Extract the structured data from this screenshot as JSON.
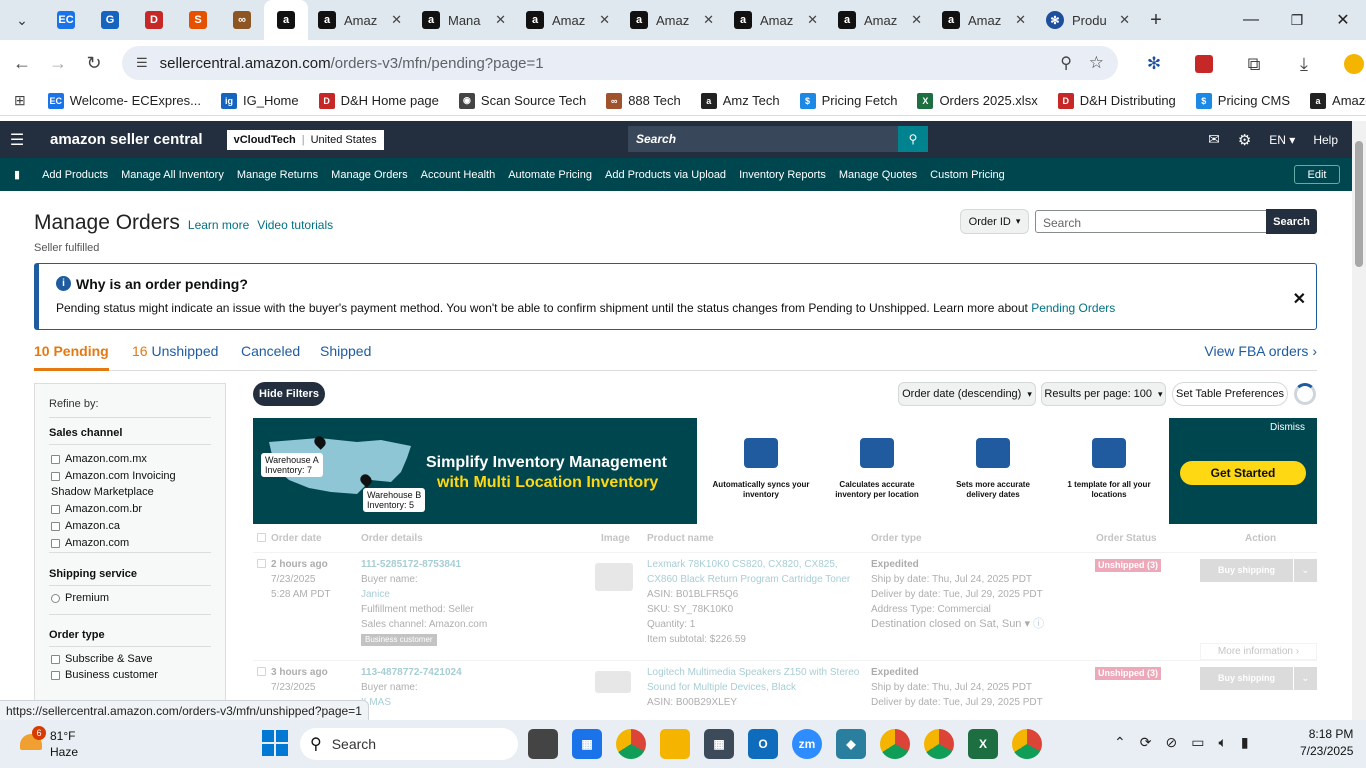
{
  "browser": {
    "tabs": [
      {
        "title": "Amaz"
      },
      {
        "title": "Mana"
      },
      {
        "title": "Amaz"
      },
      {
        "title": "Amaz"
      },
      {
        "title": "Amaz"
      },
      {
        "title": "Amaz"
      },
      {
        "title": "Amaz"
      },
      {
        "title": "Produ"
      }
    ],
    "url_host": "sellercentral.amazon.com",
    "url_path": "/orders-v3/mfn/pending?page=1",
    "bookmarks": [
      {
        "label": "Welcome- ECExpres...",
        "color": "#1a73e8",
        "icon": "EC"
      },
      {
        "label": "IG_Home",
        "color": "#1565c0",
        "icon": "ig"
      },
      {
        "label": "D&H Home page",
        "color": "#c62828",
        "icon": "D"
      },
      {
        "label": "Scan Source Tech",
        "color": "#444",
        "icon": "◉"
      },
      {
        "label": "888 Tech",
        "color": "#a0522d",
        "icon": "∞"
      },
      {
        "label": "Amz Tech",
        "color": "#222",
        "icon": "a"
      },
      {
        "label": "Pricing Fetch",
        "color": "#1e88e5",
        "icon": "$"
      },
      {
        "label": "Orders 2025.xlsx",
        "color": "#1d6f42",
        "icon": "X"
      },
      {
        "label": "D&H Distributing",
        "color": "#c62828",
        "icon": "D"
      },
      {
        "label": "Pricing CMS",
        "color": "#1e88e5",
        "icon": "$"
      },
      {
        "label": "Amazon",
        "color": "#222",
        "icon": "a"
      }
    ]
  },
  "header": {
    "logo": "amazon seller central",
    "account": "vCloudTech",
    "marketplace": "United States",
    "search_placeholder": "Search",
    "language": "EN",
    "help": "Help"
  },
  "nav": {
    "items": [
      "Add Products",
      "Manage All Inventory",
      "Manage Returns",
      "Manage Orders",
      "Account Health",
      "Automate Pricing",
      "Add Products via Upload",
      "Inventory Reports",
      "Manage Quotes",
      "Custom Pricing"
    ],
    "edit": "Edit"
  },
  "page": {
    "title": "Manage Orders",
    "learn_more": "Learn more",
    "video_tutorials": "Video tutorials",
    "subtitle": "Seller fulfilled",
    "search_type": "Order ID",
    "search_placeholder": "Search",
    "search_button": "Search"
  },
  "alert": {
    "title": "Why is an order pending?",
    "body": "Pending status might indicate an issue with the buyer's payment method. You won't be able to confirm shipment until the status changes from Pending to Unshipped. Learn more about",
    "link": "Pending Orders"
  },
  "tabs": {
    "pending": "10 Pending",
    "unshipped_count": "16",
    "unshipped": "Unshipped",
    "canceled": "Canceled",
    "shipped": "Shipped",
    "fba": "View FBA orders"
  },
  "filters": {
    "refine": "Refine by:",
    "sales_channel": "Sales channel",
    "channels": [
      "Amazon.com.mx",
      "Amazon.com Invoicing Shadow Marketplace",
      "Amazon.com.br",
      "Amazon.ca",
      "Amazon.com"
    ],
    "shipping_service": "Shipping service",
    "shipping_options": [
      "Premium"
    ],
    "order_type": "Order type",
    "order_types": [
      "Subscribe & Save",
      "Business customer"
    ]
  },
  "toolbar": {
    "hide_filters": "Hide Filters",
    "sort": "Order date (descending)",
    "results": "Results per page: 100",
    "preferences": "Set Table Preferences"
  },
  "banner": {
    "headline1": "Simplify Inventory Management",
    "headline2": "with Multi Location Inventory",
    "warehouse_a": "Warehouse A",
    "inventory_a": "Inventory: 7",
    "warehouse_b": "Warehouse B",
    "inventory_b": "Inventory: 5",
    "features": [
      {
        "text": "Automatically syncs your inventory"
      },
      {
        "text": "Calculates accurate inventory per location"
      },
      {
        "text": "Sets more accurate delivery dates"
      },
      {
        "text": "1 template for all your locations"
      }
    ],
    "dismiss": "Dismiss",
    "cta": "Get Started"
  },
  "table": {
    "headers": [
      "Order date",
      "Order details",
      "Image",
      "Product name",
      "Order type",
      "Order Status",
      "Action"
    ],
    "rows": [
      {
        "date": "2 hours ago",
        "date2": "7/23/2025",
        "time": "5:28 AM PDT",
        "order_id": "111-5285172-8753841",
        "buyer_label": "Buyer name:",
        "buyer": "Janice",
        "fulfillment": "Fulfillment method: Seller",
        "channel": "Sales channel: Amazon.com",
        "badge": "Business customer",
        "product": "Lexmark 78K10K0 CS820, CX820, CX825, CX860 Black Return Program Cartridge Toner",
        "asin": "ASIN: B01BLFR5Q6",
        "sku": "SKU: SY_78K10K0",
        "qty": "Quantity: 1",
        "subtotal": "Item subtotal: $226.59",
        "type": "Expedited",
        "ship_by": "Ship by date: Thu, Jul 24, 2025 PDT",
        "deliver_by": "Deliver by date: Tue, Jul 29, 2025 PDT",
        "address": "Address Type: Commercial",
        "destination": "Destination closed on Sat, Sun",
        "status": "Unshipped (3)",
        "action": "Buy shipping",
        "more": "More information"
      },
      {
        "date": "3 hours ago",
        "date2": "7/23/2025",
        "order_id": "113-4878772-7421024",
        "buyer_label": "Buyer name:",
        "buyer": "ILMAS",
        "product": "Logitech Multimedia Speakers Z150 with Stereo Sound for Multiple Devices, Black",
        "asin": "ASIN: B00B29XLEY",
        "type": "Expedited",
        "ship_by": "Ship by date: Thu, Jul 24, 2025 PDT",
        "deliver_by": "Deliver by date: Tue, Jul 29, 2025 PDT",
        "status": "Unshipped (3)",
        "action": "Buy shipping"
      }
    ]
  },
  "status_link": "https://sellercentral.amazon.com/orders-v3/mfn/unshipped?page=1",
  "taskbar": {
    "weather_temp": "81°F",
    "weather_desc": "Haze",
    "weather_badge": "6",
    "search": "Search",
    "time": "8:18 PM",
    "date": "7/23/2025"
  }
}
